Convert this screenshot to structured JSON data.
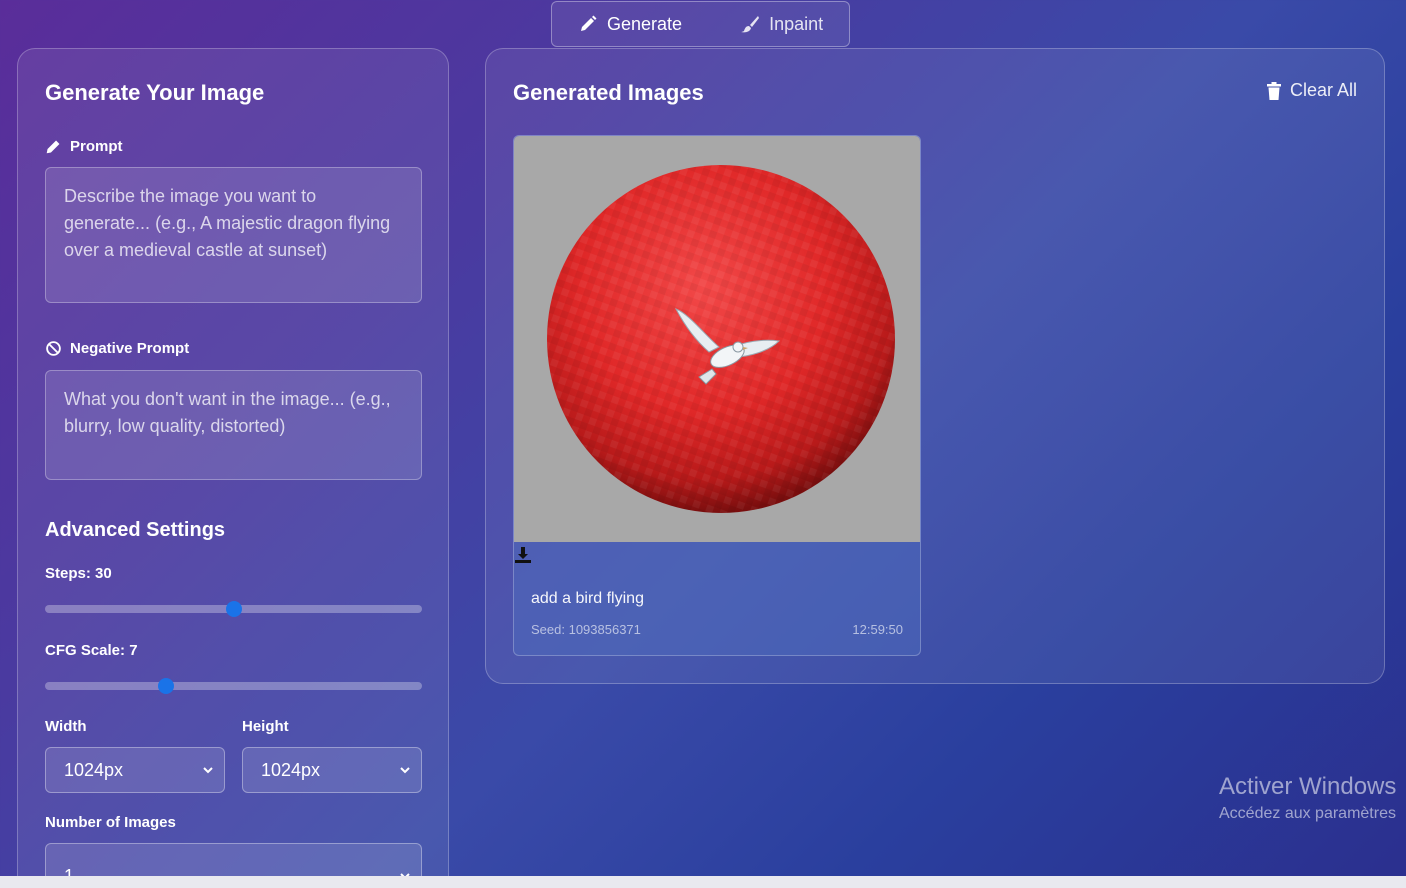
{
  "tabs": {
    "generate": "Generate",
    "inpaint": "Inpaint"
  },
  "left": {
    "title": "Generate Your Image",
    "prompt_label": "Prompt",
    "prompt_placeholder": "Describe the image you want to generate... (e.g., A majestic dragon flying over a medieval castle at sunset)",
    "negative_label": "Negative Prompt",
    "negative_placeholder": "What you don't want in the image... (e.g., blurry, low quality, distorted)",
    "advanced_title": "Advanced Settings",
    "steps_label": "Steps: 30",
    "steps_fraction": 0.5,
    "cfg_label": "CFG Scale: 7",
    "cfg_fraction": 0.32,
    "width_label": "Width",
    "width_value": "1024px",
    "height_label": "Height",
    "height_value": "1024px",
    "num_images_label": "Number of Images",
    "num_images_value": "1"
  },
  "right": {
    "title": "Generated Images",
    "clear_label": "Clear All",
    "card": {
      "caption": "add a bird flying",
      "seed": "Seed: 1093856371",
      "time": "12:59:50"
    }
  },
  "watermark": {
    "line1": "Activer Windows",
    "line2": "Accédez aux paramètres"
  },
  "colors": {
    "accent": "#1a73e8",
    "ball": "#e02828",
    "image_bg": "#a8a8a8"
  }
}
